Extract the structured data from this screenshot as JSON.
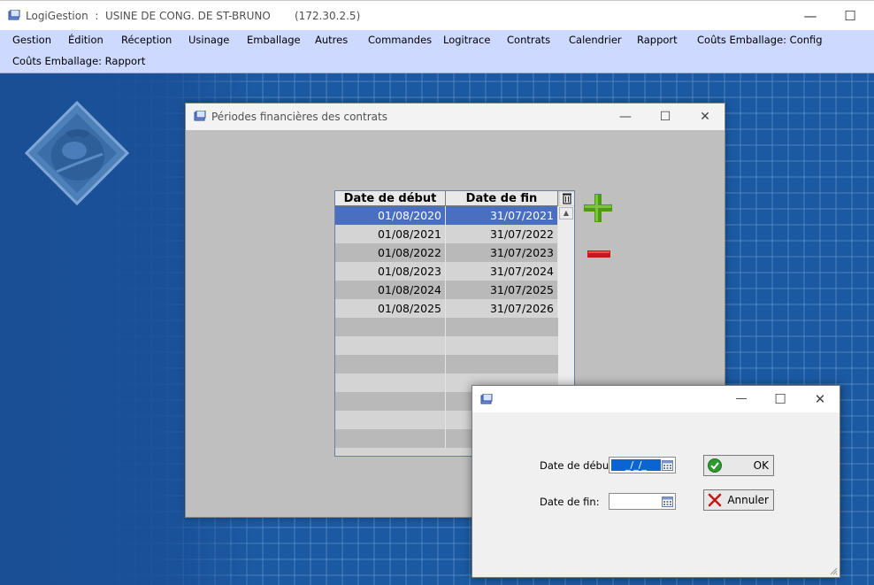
{
  "app": {
    "name": "LogiGestion",
    "site": "  :  USINE DE CONG. DE ST-BRUNO",
    "ip": "(172.30.2.5)",
    "minimize": "—",
    "maximize": "☐"
  },
  "menu": {
    "row1": [
      "Gestion",
      "Édition",
      "Réception",
      "Usinage",
      "Emballage",
      "Autres",
      "Commandes",
      "Logitrace",
      "Contrats",
      "Calendrier",
      "Rapport",
      "Coûts Emballage: Config"
    ],
    "row2": [
      "Coûts Emballage: Rapport"
    ]
  },
  "periods_window": {
    "title": "Périodes financières des contrats",
    "minimize": "—",
    "maximize": "☐",
    "close": "✕",
    "columns": [
      "Date de début",
      "Date de fin"
    ],
    "rows": [
      {
        "start": "01/08/2020",
        "end": "31/07/2021"
      },
      {
        "start": "01/08/2021",
        "end": "31/07/2022"
      },
      {
        "start": "01/08/2022",
        "end": "31/07/2023"
      },
      {
        "start": "01/08/2023",
        "end": "31/07/2024"
      },
      {
        "start": "01/08/2024",
        "end": "31/07/2025"
      },
      {
        "start": "01/08/2025",
        "end": "31/07/2026"
      }
    ],
    "selected_row": 0,
    "colors": {
      "add": "#4e9a16",
      "remove": "#c81818",
      "selection": "#4a6fc0"
    }
  },
  "dialog": {
    "minimize": "—",
    "maximize": "☐",
    "close": "✕",
    "start_label": "Date de début:",
    "start_value": "_/_/_",
    "end_label": "Date de fin:",
    "end_value": "",
    "ok_label": "OK",
    "cancel_label": "Annuler"
  }
}
